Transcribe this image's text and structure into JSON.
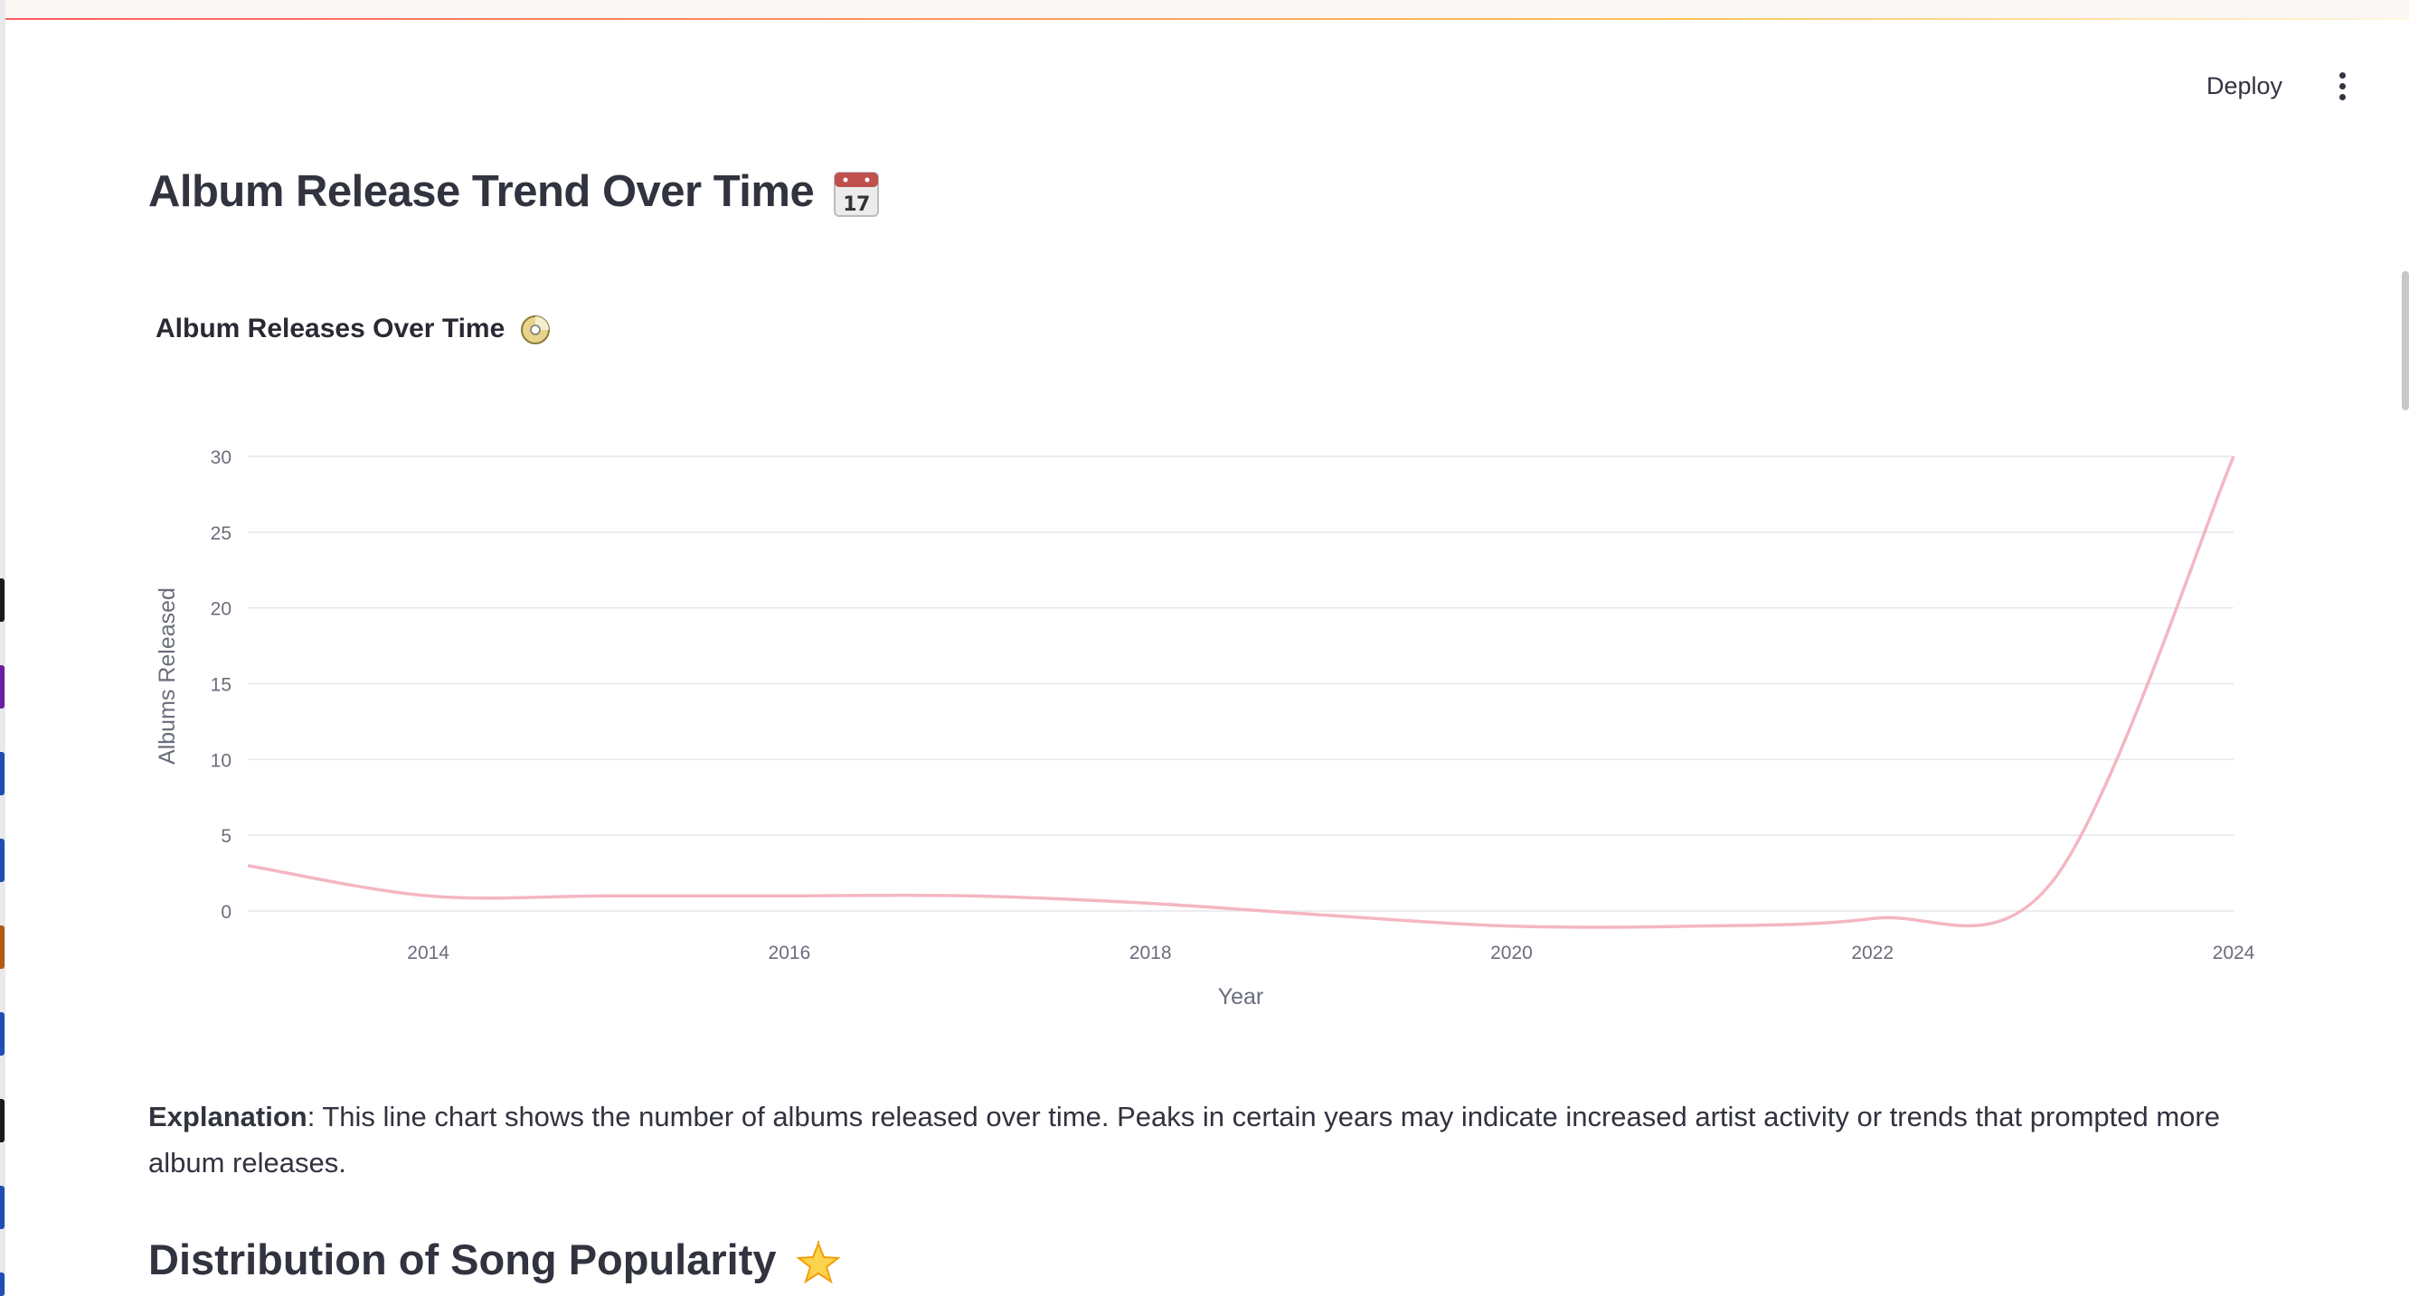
{
  "header": {
    "deploy_label": "Deploy",
    "menu_icon": "vertical-ellipsis-icon",
    "accent_gradient": [
      "#ff4b4b",
      "#ffbd45"
    ]
  },
  "page_title": "Album Release Trend Over Time",
  "page_title_icon": "calendar-icon",
  "chart_card": {
    "title": "Album Releases Over Time",
    "title_icon": "dvd-disc-icon"
  },
  "chart_data": {
    "type": "line",
    "title": "Album Releases Over Time",
    "xlabel": "Year",
    "ylabel": "Albums Released",
    "x_ticks": [
      "2014",
      "2016",
      "2018",
      "2020",
      "2022",
      "2024"
    ],
    "y_ticks": [
      "0",
      "5",
      "10",
      "15",
      "20",
      "25",
      "30"
    ],
    "xlim": [
      2013,
      2024
    ],
    "ylim": [
      0,
      30
    ],
    "grid": true,
    "line_shape": "spline",
    "series": [
      {
        "color": "#f4b6c2",
        "x": [
          2013,
          2014,
          2015,
          2016,
          2017,
          2018,
          2019,
          2020,
          2021,
          2022,
          2023,
          2024
        ],
        "y": [
          3,
          1,
          1,
          1,
          1,
          0.5,
          -0.3,
          -1,
          -1,
          -0.5,
          2,
          30
        ]
      }
    ]
  },
  "explanation": {
    "label": "Explanation",
    "text": ": This line chart shows the number of albums released over time. Peaks in certain years may indicate increased artist activity or trends that prompted more album releases."
  },
  "section2_title": "Distribution of Song Popularity",
  "section2_icon": "glowing-star-icon"
}
